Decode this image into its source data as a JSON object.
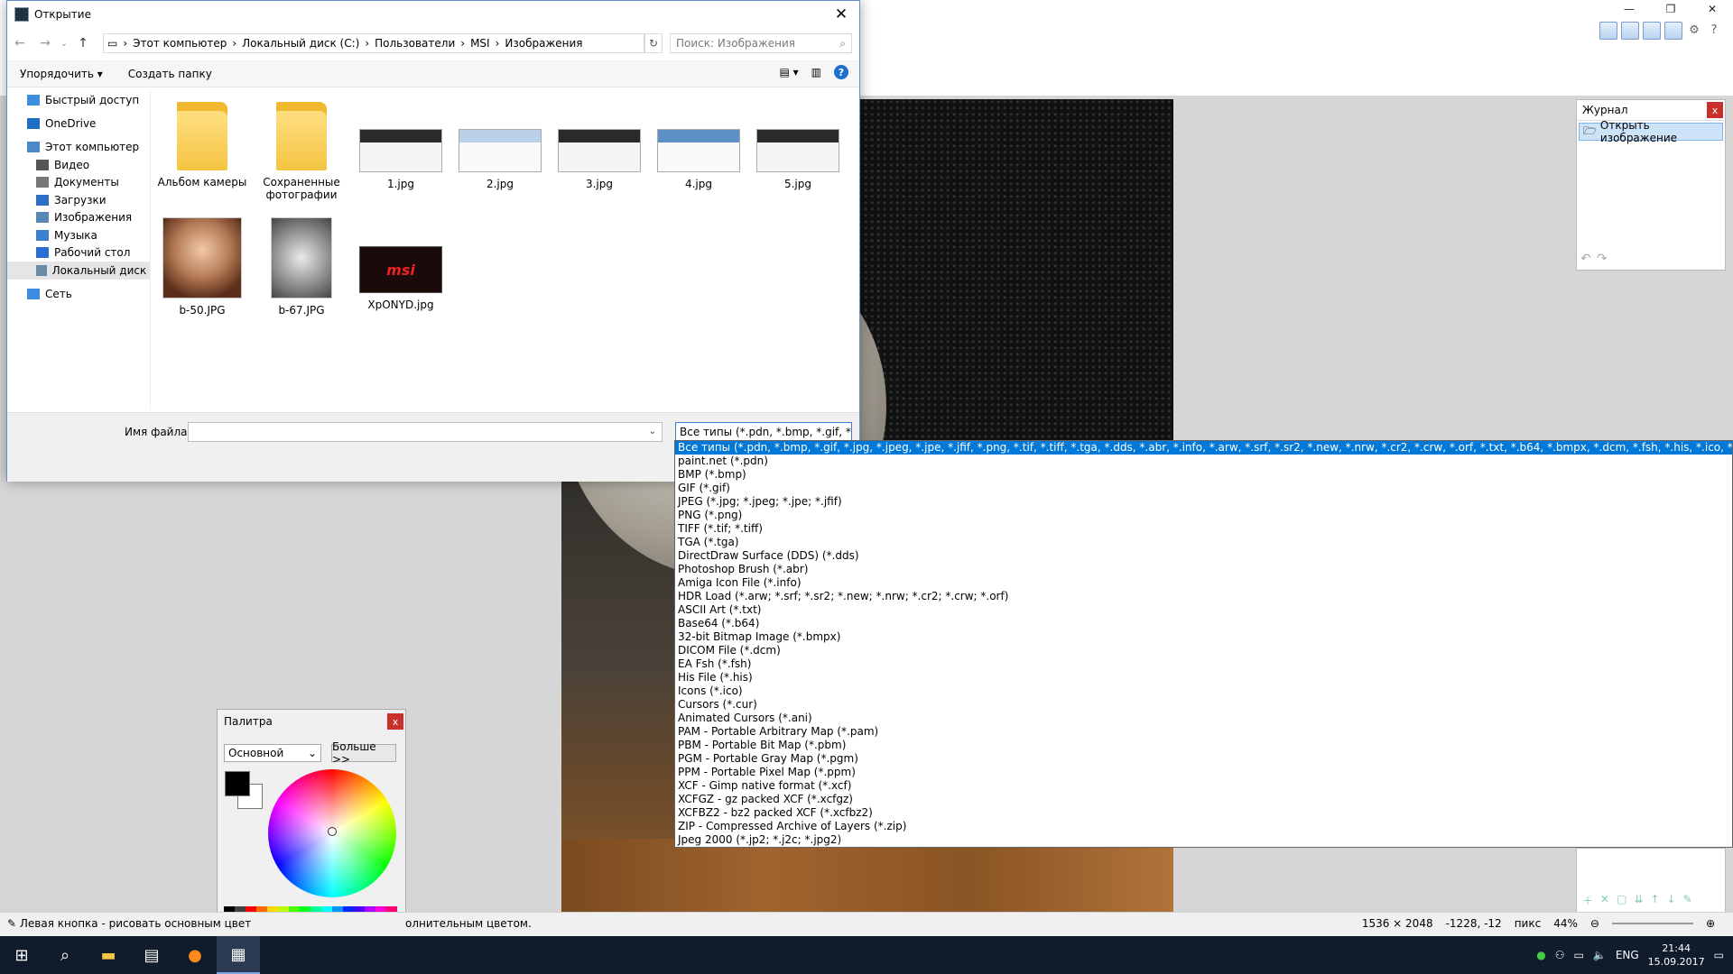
{
  "dialog": {
    "title": "Открытие",
    "close": "✕",
    "address": [
      "Этот компьютер",
      "Локальный диск (C:)",
      "Пользователи",
      "MSI",
      "Изображения"
    ],
    "search_placeholder": "Поиск: Изображения",
    "cmd_organize": "Упорядочить ▾",
    "cmd_new_folder": "Создать папку",
    "help": "?",
    "tree": [
      "Быстрый доступ",
      "OneDrive",
      "Этот компьютер",
      "Видео",
      "Документы",
      "Загрузки",
      "Изображения",
      "Музыка",
      "Рабочий стол",
      "Локальный диск (C:)",
      "Сеть"
    ],
    "files": [
      "Альбом камеры",
      "Сохраненные фотографии",
      "1.jpg",
      "2.jpg",
      "3.jpg",
      "4.jpg",
      "5.jpg",
      "b-50.JPG",
      "b-67.JPG",
      "XpONYD.jpg"
    ],
    "filename_label": "Имя файла:",
    "filetype_selected": "Все типы (*.pdn, *.bmp, *.gif, *"
  },
  "filetypes": [
    "Все типы (*.pdn, *.bmp, *.gif, *.jpg, *.jpeg, *.jpe, *.jfif, *.png, *.tif, *.tiff, *.tga, *.dds, *.abr, *.info, *.arw, *.srf, *.sr2, *.new, *.nrw, *.cr2, *.crw, *.orf, *.txt, *.b64, *.bmpx, *.dcm, *.fsh, *.his, *.ico, *.cur, *.ani, *.pam, *.pbm, *.pgm, *",
    "paint.net (*.pdn)",
    "BMP (*.bmp)",
    "GIF (*.gif)",
    "JPEG (*.jpg; *.jpeg; *.jpe; *.jfif)",
    "PNG (*.png)",
    "TIFF (*.tif; *.tiff)",
    "TGA (*.tga)",
    "DirectDraw Surface (DDS) (*.dds)",
    "Photoshop Brush (*.abr)",
    "Amiga Icon File (*.info)",
    "HDR Load (*.arw; *.srf; *.sr2; *.new; *.nrw; *.cr2; *.crw; *.orf)",
    "ASCII Art (*.txt)",
    "Base64 (*.b64)",
    "32-bit Bitmap Image (*.bmpx)",
    "DICOM File (*.dcm)",
    "EA Fsh (*.fsh)",
    "His File (*.his)",
    "Icons (*.ico)",
    "Cursors (*.cur)",
    "Animated Cursors (*.ani)",
    "PAM - Portable Arbitrary Map (*.pam)",
    "PBM - Portable Bit Map (*.pbm)",
    "PGM - Portable Gray Map (*.pgm)",
    "PPM - Portable Pixel Map (*.ppm)",
    "XCF - Gimp native format (*.xcf)",
    "XCFGZ - gz packed XCF (*.xcfgz)",
    "XCFBZ2 - bz2 packed XCF (*.xcfbz2)",
    "ZIP - Compressed Archive of Layers (*.zip)",
    "Jpeg 2000 (*.jp2; *.j2c; *.jpg2)"
  ],
  "journal": {
    "title": "Журнал",
    "item": "Открыть изображение"
  },
  "palette": {
    "title": "Палитра",
    "select": "Основной",
    "more": "Больше >>"
  },
  "status": {
    "left": "Левая кнопка - рисовать основным цвет",
    "left_tail": "олнительным цветом.",
    "size": "1536 × 2048",
    "coords": "-1228, -12",
    "units": "пикс",
    "zoom": "44%"
  },
  "tray": {
    "lang": "ENG",
    "time": "21:44",
    "date": "15.09.2017"
  }
}
